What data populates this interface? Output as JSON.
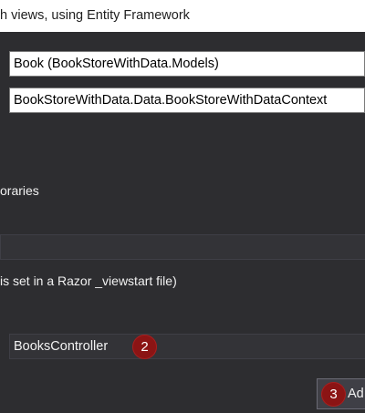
{
  "window": {
    "title": "h views, using Entity Framework"
  },
  "form": {
    "model_class": "Book (BookStoreWithData.Models)",
    "data_context_class": "BookStoreWithData.Data.BookStoreWithDataContext",
    "libraries_label": "oraries",
    "layout_page_value": "",
    "layout_hint": "is set in a Razor _viewstart file)",
    "controller_name": "BooksController",
    "controller_step": "2"
  },
  "actions": {
    "add_step": "3",
    "add_label": "Ad"
  },
  "colors": {
    "dialog_background": "#2d2d30",
    "step_badge": "#8b1414"
  }
}
